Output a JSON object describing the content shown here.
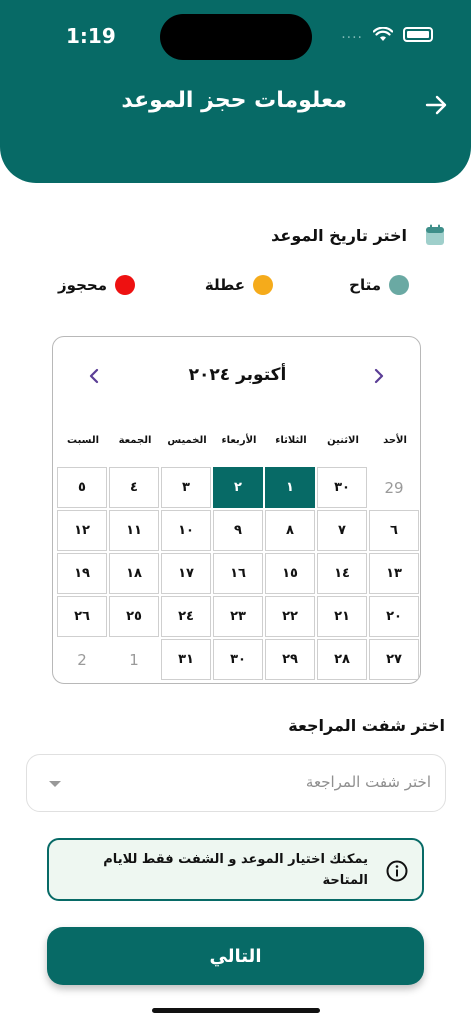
{
  "status_bar": {
    "time": "1:19",
    "signal": "....",
    "colors": {
      "signal_dots": "#7fb9b6"
    }
  },
  "header": {
    "title": "معلومات حجز الموعد",
    "back_icon": "arrow-right-icon",
    "color": "#076a66"
  },
  "date_section": {
    "title": "اختر تاريخ الموعد",
    "icon": "calendar-icon"
  },
  "legend": [
    {
      "label": "متاح",
      "color": "#6aa9a3"
    },
    {
      "label": "عطلة",
      "color": "#f5ab1b"
    },
    {
      "label": "محجوز",
      "color": "#ee1111"
    }
  ],
  "calendar": {
    "month": "أكتوبر ٢٠٢٤",
    "weekdays": [
      "الأحد",
      "الاثنين",
      "الثلاثاء",
      "الأربعاء",
      "الخميس",
      "الجمعة",
      "السبت"
    ],
    "weeks": [
      [
        "29",
        "٣٠",
        "١",
        "٢",
        "٣",
        "٤",
        "٥"
      ],
      [
        "٦",
        "٧",
        "٨",
        "٩",
        "١٠",
        "١١",
        "١٢"
      ],
      [
        "١٣",
        "١٤",
        "١٥",
        "١٦",
        "١٧",
        "١٨",
        "١٩"
      ],
      [
        "٢٠",
        "٢١",
        "٢٢",
        "٢٣",
        "٢٤",
        "٢٥",
        "٢٦"
      ],
      [
        "٢٧",
        "٢٨",
        "٢٩",
        "٣٠",
        "٣١",
        "1",
        "2"
      ]
    ],
    "outside_month": [
      [
        0,
        0
      ],
      [
        4,
        5
      ],
      [
        4,
        6
      ]
    ],
    "selected": [
      [
        0,
        2
      ],
      [
        0,
        3
      ]
    ]
  },
  "shift_section": {
    "title": "اختر شفت المراجعة",
    "placeholder": "اختر شفت المراجعة"
  },
  "info": {
    "text": "يمكنك اختيار الموعد و الشفت فقط للايام المتاحة",
    "icon": "info-icon"
  },
  "next_button": {
    "label": "التالي"
  }
}
